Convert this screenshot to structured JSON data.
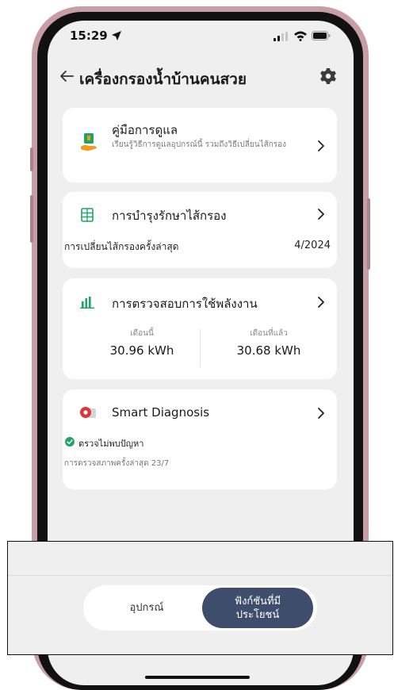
{
  "status_bar": {
    "time": "15:29"
  },
  "header": {
    "title": "เครื่องกรองน้ำบ้านคนสวย"
  },
  "guide_card": {
    "title": "คู่มือการดูแล",
    "subtitle": "เรียนรู้วิธีการดูแลอุปกรณ์นี้ รวมถึงวิธีเปลี่ยนไส้กรอง"
  },
  "filter_card": {
    "title": "การบำรุงรักษาไส้กรอง",
    "last_change_label": "การเปลี่ยนไส้กรองครั้งล่าสุด",
    "last_change_value": "4/2024"
  },
  "energy_card": {
    "title": "การตรวจสอบการใช้พลังงาน",
    "this_month_label": "เดือนนี้",
    "this_month_value": "30.96 kWh",
    "last_month_label": "เดือนที่แล้ว",
    "last_month_value": "30.68 kWh"
  },
  "diagnosis_card": {
    "title": "Smart Diagnosis",
    "status": "ตรวจไม่พบปัญหา",
    "last_check": "การตรวจสภาพครั้งล่าสุด 23/7"
  },
  "bottom_nav": {
    "devices_label": "อุปกรณ์",
    "features_label": "ฟังก์ชันที่มีประโยชน์"
  },
  "colors": {
    "accent_green": "#1fa463",
    "nav_active": "#3e4d6b",
    "guide_icon_orange": "#f29b1d",
    "diagnosis_red": "#e0343c"
  },
  "icons": [
    "location-arrow-icon",
    "signal-icon",
    "wifi-icon",
    "battery-icon",
    "back-arrow-icon",
    "gear-icon",
    "hand-book-icon",
    "filter-grid-icon",
    "bar-chart-icon",
    "diagnosis-icon",
    "check-circle-icon",
    "chevron-right-icon"
  ]
}
